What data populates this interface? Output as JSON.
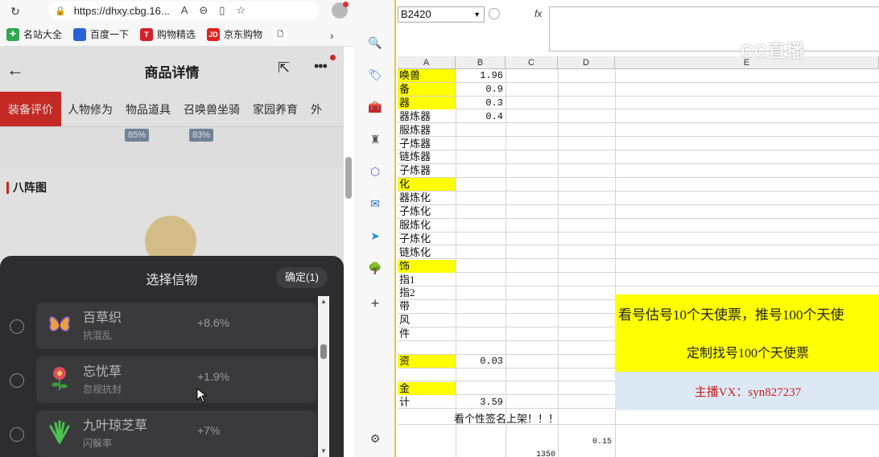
{
  "browser": {
    "url": "https://dhxy.cbg.16...",
    "favorites": [
      {
        "label": "名站大全",
        "color": "#2fa84f",
        "glyph": "✚"
      },
      {
        "label": "百度一下",
        "color": "#2b62d9",
        "glyph": "🐾"
      },
      {
        "label": "购物精选",
        "color": "#d8202a",
        "glyph": "T"
      },
      {
        "label": "京东购物",
        "color": "#e02020",
        "glyph": "JD"
      },
      {
        "label": "",
        "color": "#ffffff",
        "glyph": "🗋"
      }
    ]
  },
  "page": {
    "title": "商品详情",
    "tabs": [
      "装备评价",
      "人物修为",
      "物品道具",
      "召唤兽坐骑",
      "家园养育",
      "外"
    ],
    "active_tab": "装备评价",
    "percents": [
      "85%",
      "83%"
    ],
    "section_title": "八阵图"
  },
  "modal": {
    "title": "选择信物",
    "confirm_label": "确定(1)",
    "items": [
      {
        "name": "百草织",
        "sub": "抗混乱",
        "value": "+8.6%",
        "icon": "butterfly-icon"
      },
      {
        "name": "忘忧草",
        "sub": "忽视抗封",
        "value": "+1.9%",
        "icon": "flower-icon"
      },
      {
        "name": "九叶琼芝草",
        "sub": "闪躲率",
        "value": "+7%",
        "icon": "herb-icon"
      }
    ]
  },
  "sheet": {
    "name_box": "B2420",
    "fx": "fx",
    "columns": [
      "A",
      "B",
      "C",
      "D",
      "E"
    ],
    "rows": [
      {
        "a": "唤兽",
        "b": "1.96",
        "yellow": true
      },
      {
        "a": "备",
        "b": "0.9",
        "yellow": true
      },
      {
        "a": "器",
        "b": "0.3",
        "yellow": true
      },
      {
        "a": "器炼器",
        "b": "0.4",
        "yellow": false
      },
      {
        "a": "服炼器",
        "b": "",
        "yellow": false
      },
      {
        "a": "子炼器",
        "b": "",
        "yellow": false
      },
      {
        "a": "链炼器",
        "b": "",
        "yellow": false
      },
      {
        "a": "子炼器",
        "b": "",
        "yellow": false
      },
      {
        "a": "化",
        "b": "",
        "yellow": true
      },
      {
        "a": "器炼化",
        "b": "",
        "yellow": false
      },
      {
        "a": "子炼化",
        "b": "",
        "yellow": false
      },
      {
        "a": "服炼化",
        "b": "",
        "yellow": false
      },
      {
        "a": "子炼化",
        "b": "",
        "yellow": false
      },
      {
        "a": "链炼化",
        "b": "",
        "yellow": false
      },
      {
        "a": "饰",
        "b": "",
        "yellow": true
      },
      {
        "a": "指1",
        "b": "",
        "yellow": false
      },
      {
        "a": "指2",
        "b": "",
        "yellow": false
      },
      {
        "a": "带",
        "b": "",
        "yellow": false
      },
      {
        "a": "风",
        "b": "",
        "yellow": false
      },
      {
        "a": "件",
        "b": "",
        "yellow": false
      },
      {
        "a": "",
        "b": "",
        "yellow": false
      },
      {
        "a": "资",
        "b": "0.03",
        "yellow": true
      },
      {
        "a": "",
        "b": "",
        "yellow": false
      },
      {
        "a": "金",
        "b": "",
        "yellow": true
      },
      {
        "a": "计",
        "b": "3.59",
        "yellow": false
      }
    ],
    "banner1": "看号估号10个天使票，推号100个天使",
    "banner2": "定制找号100个天使票",
    "banner3": "主播VX：syn827237",
    "notice": "看个性签名上架！！！",
    "num_d": "0.15",
    "num_c": "1350",
    "logo": "CC直播"
  }
}
